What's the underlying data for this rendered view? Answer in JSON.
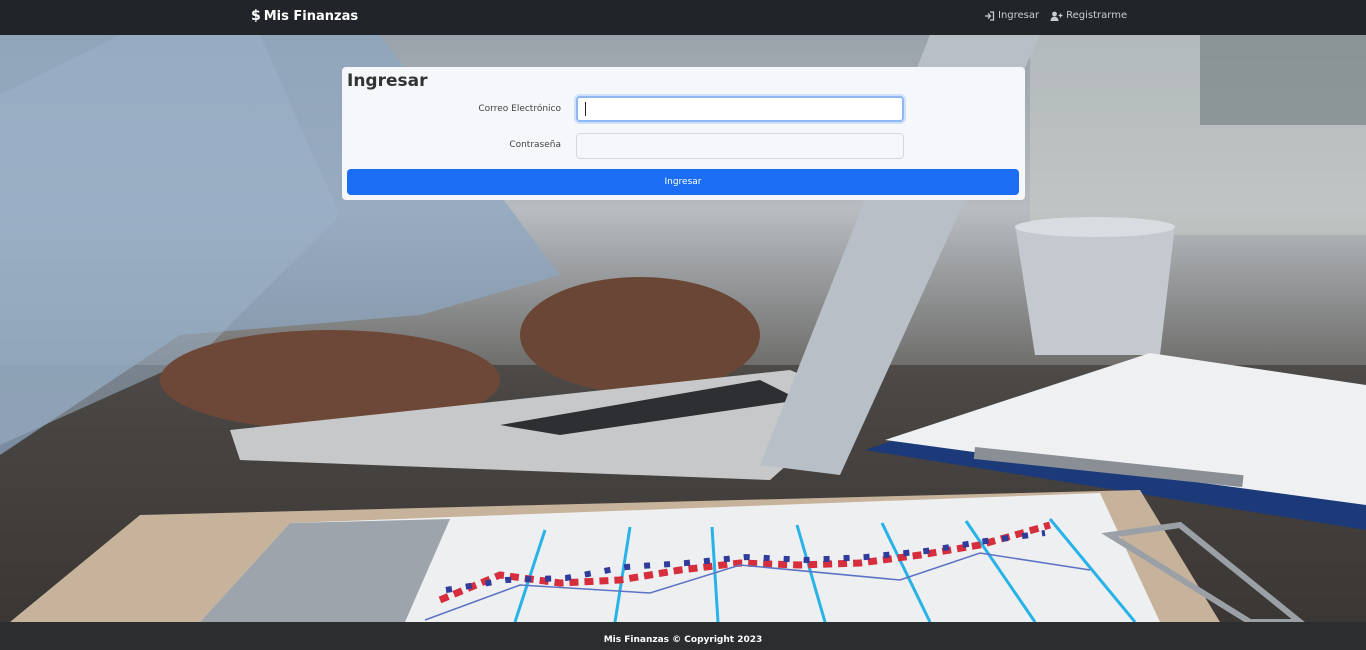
{
  "navbar": {
    "brand": "Mis Finanzas",
    "links": [
      {
        "label": "Ingresar",
        "icon": "sign-in-icon"
      },
      {
        "label": "Registrarme",
        "icon": "user-plus-icon"
      }
    ]
  },
  "login": {
    "title": "Ingresar",
    "email_label": "Correo Electrónico",
    "email_value": "",
    "password_label": "Contraseña",
    "password_value": "",
    "submit_label": "Ingresar"
  },
  "footer": {
    "text": "Mis Finanzas © Copyright 2023"
  },
  "colors": {
    "primary": "#1b6ef3",
    "navbar": "#212529",
    "card": "#f5f7fa"
  }
}
